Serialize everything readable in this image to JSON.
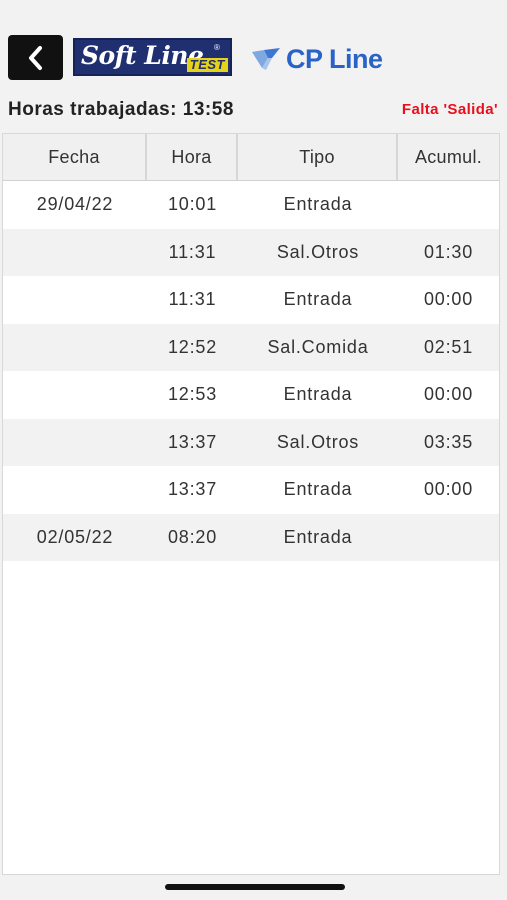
{
  "header": {
    "back_icon": "chevron-left-icon",
    "softline_logo_text": "Soft Line",
    "softline_logo_mark": "®",
    "softline_test_tag": "TEST",
    "cpline_logo_text": "CP Line",
    "cpline_icon": "cpline-emblem-icon"
  },
  "summary": {
    "hours_label": "Horas trabajadas: 13:58",
    "warning": "Falta 'Salida'"
  },
  "table": {
    "columns": [
      "Fecha",
      "Hora",
      "Tipo",
      "Acumul."
    ],
    "rows": [
      {
        "fecha": "29/04/22",
        "hora": "10:01",
        "tipo": "Entrada",
        "acumul": ""
      },
      {
        "fecha": "",
        "hora": "11:31",
        "tipo": "Sal.Otros",
        "acumul": "01:30"
      },
      {
        "fecha": "",
        "hora": "11:31",
        "tipo": "Entrada",
        "acumul": "00:00"
      },
      {
        "fecha": "",
        "hora": "12:52",
        "tipo": "Sal.Comida",
        "acumul": "02:51"
      },
      {
        "fecha": "",
        "hora": "12:53",
        "tipo": "Entrada",
        "acumul": "00:00"
      },
      {
        "fecha": "",
        "hora": "13:37",
        "tipo": "Sal.Otros",
        "acumul": "03:35"
      },
      {
        "fecha": "",
        "hora": "13:37",
        "tipo": "Entrada",
        "acumul": "00:00"
      },
      {
        "fecha": "02/05/22",
        "hora": "08:20",
        "tipo": "Entrada",
        "acumul": ""
      }
    ]
  },
  "colors": {
    "warning": "#e8101c",
    "brand_navy": "#1f2f70",
    "brand_yellow": "#e7d21a",
    "cpline_blue": "#2a63c8"
  }
}
